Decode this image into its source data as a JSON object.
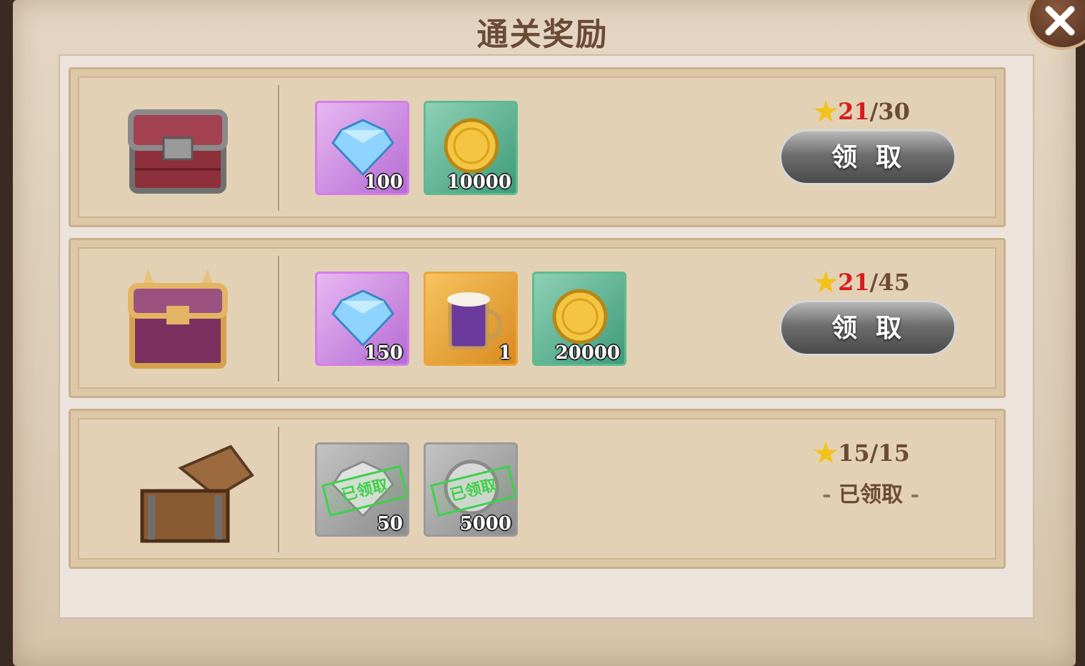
{
  "title": "通关奖励",
  "close_icon": "close-icon",
  "rows": [
    {
      "chest": "silver-chest",
      "items": [
        {
          "icon": "diamond-icon",
          "qty": "100",
          "frame": "purple"
        },
        {
          "icon": "gold-coin-icon",
          "qty": "10000",
          "frame": "green"
        }
      ],
      "stars_current": "21",
      "stars_total": "/30",
      "button_label": "领取"
    },
    {
      "chest": "horned-gold-chest",
      "items": [
        {
          "icon": "diamond-icon",
          "qty": "150",
          "frame": "purple"
        },
        {
          "icon": "mug-icon",
          "qty": "1",
          "frame": "orange"
        },
        {
          "icon": "gold-coin-icon",
          "qty": "20000",
          "frame": "green"
        }
      ],
      "stars_current": "21",
      "stars_total": "/45",
      "button_label": "领取"
    },
    {
      "chest": "open-wooden-chest",
      "items": [
        {
          "icon": "diamond-icon",
          "qty": "50",
          "frame": "gray",
          "stamp": "已领取"
        },
        {
          "icon": "coin-icon",
          "qty": "5000",
          "frame": "gray",
          "stamp": "已领取"
        }
      ],
      "stars_current": "15",
      "stars_total": "/15",
      "claimed_label": "已领取",
      "dash_left": "-",
      "dash_right": "-"
    }
  ],
  "colors": {
    "star_current_unmet": "#d61d1d",
    "stamp_green": "#3dd14a"
  }
}
